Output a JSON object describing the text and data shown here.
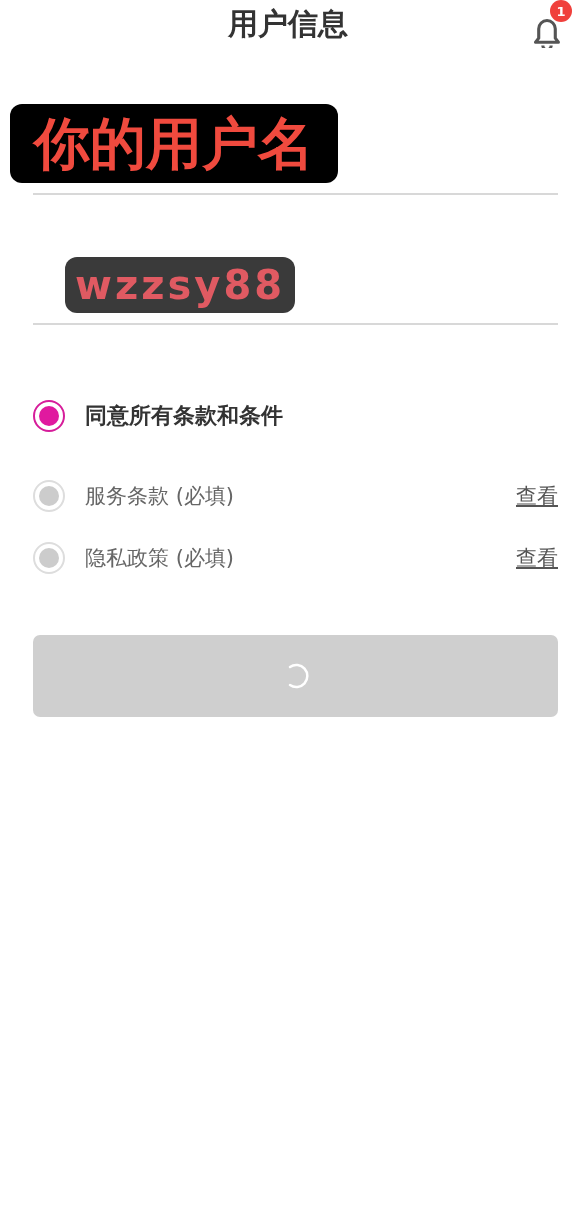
{
  "header": {
    "title": "用户信息",
    "notification_badge": "1"
  },
  "fields": [
    {
      "annotation": "你的用户名",
      "kind": "black"
    },
    {
      "annotation": "wzzsy88",
      "kind": "grey"
    }
  ],
  "agree_all": {
    "label": "同意所有条款和条件",
    "selected": true
  },
  "terms": [
    {
      "label": "服务条款 (必填)",
      "selected": false,
      "link": "查看"
    },
    {
      "label": "隐私政策 (必填)",
      "selected": false,
      "link": "查看"
    }
  ],
  "submit": {
    "loading": true,
    "disabled": true
  }
}
